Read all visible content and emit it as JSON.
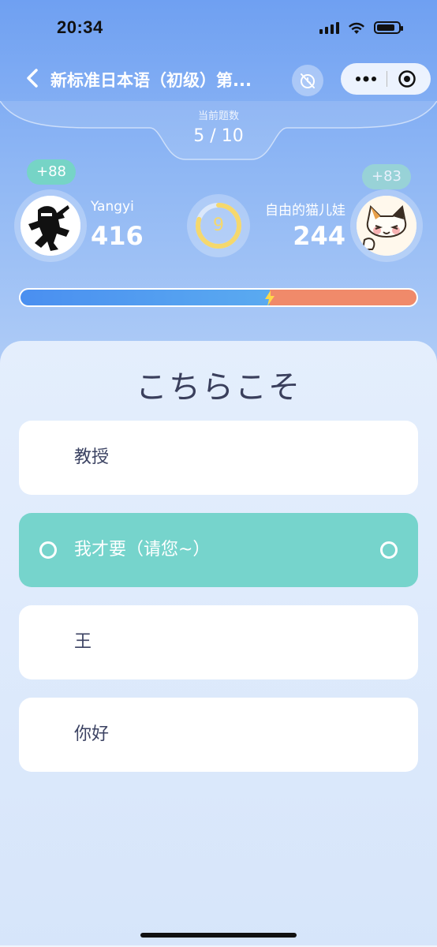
{
  "status_bar": {
    "time": "20:34",
    "icons": [
      "signal-icon",
      "wifi-icon",
      "battery-icon"
    ]
  },
  "nav": {
    "title": "新标准日本语（初级）第...",
    "back_icon": "chevron-left-icon",
    "timer_icon": "timer-off-icon",
    "menu_icon": "more-dots-icon",
    "close_icon": "target-circle-icon"
  },
  "counter": {
    "label": "当前题数",
    "value": "5 / 10"
  },
  "players": {
    "left": {
      "name": "Yangyi",
      "score": "416",
      "gain": "+88"
    },
    "right": {
      "name": "自由的猫儿娃",
      "score": "244",
      "gain": "+83"
    }
  },
  "timer": {
    "seconds": "9",
    "fraction_remaining": 0.8
  },
  "progress": {
    "left_fraction": 0.63,
    "left_color": "#4a8ff0",
    "right_color": "#f08a6a"
  },
  "question": {
    "text": "こちらこそ"
  },
  "options": [
    {
      "label": "教授",
      "selected": false
    },
    {
      "label": "我才要（请您~）",
      "selected": true
    },
    {
      "label": "王",
      "selected": false
    },
    {
      "label": "你好",
      "selected": false
    }
  ],
  "colors": {
    "accent_teal": "#76d4cc",
    "timer_yellow": "#f5d86d"
  }
}
